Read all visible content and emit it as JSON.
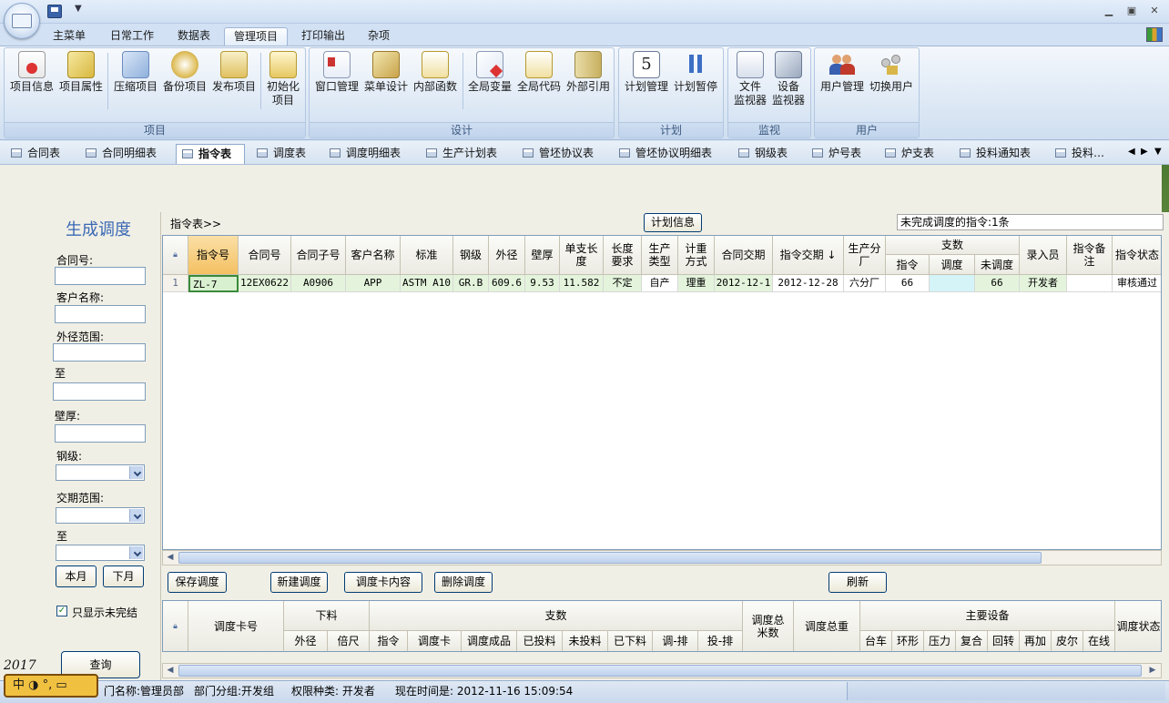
{
  "ribbon": {
    "tabs": [
      "主菜单",
      "日常工作",
      "数据表",
      "管理项目",
      "打印输出",
      "杂项"
    ],
    "active_tab": "管理项目",
    "groups": [
      {
        "label": "项目",
        "buttons": [
          "项目信息",
          "项目属性",
          "压缩项目",
          "备份项目",
          "发布项目",
          "初始化\n项目"
        ]
      },
      {
        "label": "设计",
        "buttons": [
          "窗口管理",
          "菜单设计",
          "内部函数",
          "全局变量",
          "全局代码",
          "外部引用"
        ]
      },
      {
        "label": "计划",
        "buttons": [
          "计划管理",
          "计划暂停"
        ]
      },
      {
        "label": "监视",
        "buttons": [
          "文件\n监视器",
          "设备\n监视器"
        ]
      },
      {
        "label": "用户",
        "buttons": [
          "用户管理",
          "切换用户"
        ]
      }
    ]
  },
  "doc_tabs": [
    "合同表",
    "合同明细表",
    "指令表",
    "调度表",
    "调度明细表",
    "生产计划表",
    "管坯协议表",
    "管坯协议明细表",
    "钢级表",
    "炉号表",
    "炉支表",
    "投料通知表",
    "投料…"
  ],
  "active_doc_tab": "指令表",
  "left_panel": {
    "title": "生成调度",
    "labels": {
      "contract_no": "合同号:",
      "customer": "客户名称:",
      "od_range": "外径范围:",
      "to1": "至",
      "wall": "壁厚:",
      "steel_grade": "钢级:",
      "due_range": "交期范围:",
      "to2": "至"
    },
    "buttons": {
      "this_month": "本月",
      "next_month": "下月",
      "query": "查询"
    },
    "checkbox_label": "只显示未完结",
    "checkbox_checked": true,
    "year_scribble": "2017"
  },
  "main": {
    "breadcrumb": "指令表>>",
    "plan_info_button": "计划信息",
    "unfinished_text": "未完成调度的指令:1条",
    "grid1": {
      "headers": [
        "指令号",
        "合同号",
        "合同子号",
        "客户名称",
        "标准",
        "钢级",
        "外径",
        "壁厚",
        "单支长度",
        "长度要求",
        "生产类型",
        "计重方式",
        "合同交期",
        "指令交期 ↓",
        "生产分厂",
        "支数",
        "指令",
        "调度",
        "未调度",
        "录入员",
        "指令备注",
        "指令状态"
      ],
      "rows": [
        {
          "rownum": "1",
          "cells": [
            "ZL-7",
            "12EX0622",
            "A0906",
            "APP",
            "ASTM A10",
            "GR.B",
            "609.6",
            "9.53",
            "11.582",
            "不定",
            "自产",
            "理重",
            "2012-12-1",
            "2012-12-28",
            "六分厂",
            "66",
            "",
            "66",
            "开发者",
            "",
            "审核通过"
          ]
        }
      ]
    },
    "actions": {
      "save": "保存调度",
      "new": "新建调度",
      "card": "调度卡内容",
      "delete": "删除调度",
      "refresh": "刷新"
    },
    "grid2": {
      "headers": [
        "调度卡号",
        "下料",
        "外径",
        "倍尺",
        "支数",
        "指令",
        "调度卡",
        "调度成品",
        "已投料",
        "未投料",
        "已下料",
        "调-排",
        "投-排",
        "调度总米数",
        "调度总重",
        "主要设备",
        "台车",
        "环形",
        "压力",
        "复合",
        "回转",
        "再加",
        "皮尔",
        "在线",
        "调度状态"
      ]
    }
  },
  "status_bar": {
    "dept": "门名称:管理员部",
    "group": "部门分组:开发组",
    "perm": "权限种类: 开发者",
    "time": "现在时间是: 2012-11-16 15:09:54"
  },
  "ime": "中 ◑ °, ▭",
  "colors": {
    "accent": "#3a68b4",
    "selected_row": "#d8f0d0",
    "ribbon_bg": "#dae6f4",
    "highlight_header": "#f7c870"
  }
}
